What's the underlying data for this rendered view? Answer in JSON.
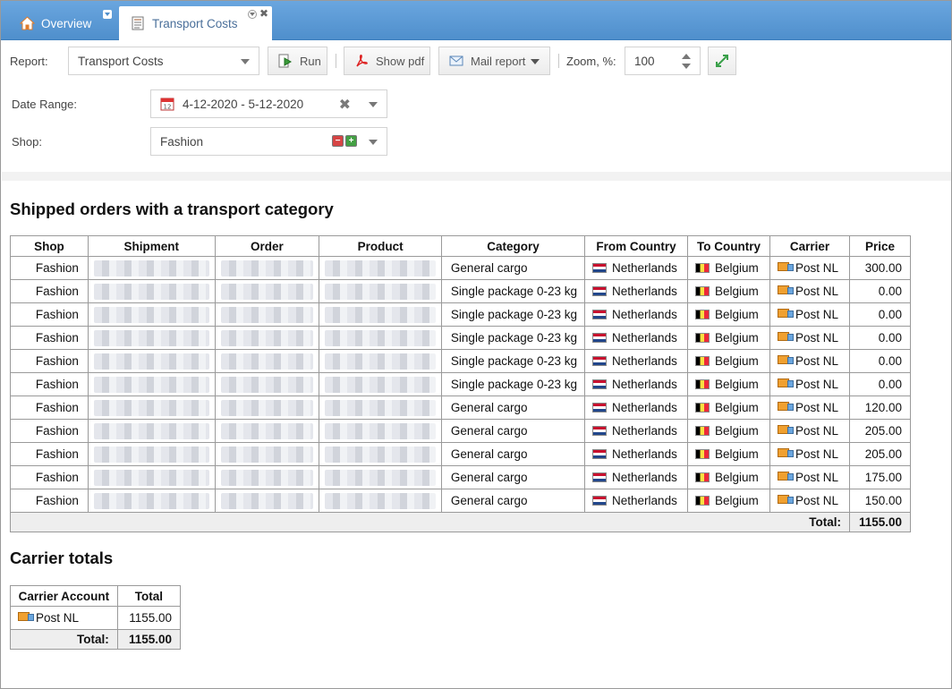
{
  "tabs": [
    {
      "label": "Overview",
      "icon": "home-icon",
      "active": false
    },
    {
      "label": "Transport Costs",
      "icon": "report-icon",
      "active": true
    }
  ],
  "toolbar": {
    "report_label": "Report:",
    "report_value": "Transport Costs",
    "run_label": "Run",
    "show_pdf_label": "Show pdf",
    "mail_report_label": "Mail report",
    "zoom_label": "Zoom, %:",
    "zoom_value": "100"
  },
  "filters": {
    "date_range_label": "Date Range:",
    "date_range_value": "4-12-2020 - 5-12-2020",
    "shop_label": "Shop:",
    "shop_value": "Fashion"
  },
  "shipped_orders": {
    "title": "Shipped orders with a transport category",
    "columns": [
      "Shop",
      "Shipment",
      "Order",
      "Product",
      "Category",
      "From Country",
      "To Country",
      "Carrier",
      "Price"
    ],
    "rows": [
      {
        "shop": "Fashion",
        "category": "General cargo",
        "from": "Netherlands",
        "to": "Belgium",
        "carrier": "Post NL",
        "price": "300.00"
      },
      {
        "shop": "Fashion",
        "category": "Single package 0-23 kg",
        "from": "Netherlands",
        "to": "Belgium",
        "carrier": "Post NL",
        "price": "0.00"
      },
      {
        "shop": "Fashion",
        "category": "Single package 0-23 kg",
        "from": "Netherlands",
        "to": "Belgium",
        "carrier": "Post NL",
        "price": "0.00"
      },
      {
        "shop": "Fashion",
        "category": "Single package 0-23 kg",
        "from": "Netherlands",
        "to": "Belgium",
        "carrier": "Post NL",
        "price": "0.00"
      },
      {
        "shop": "Fashion",
        "category": "Single package 0-23 kg",
        "from": "Netherlands",
        "to": "Belgium",
        "carrier": "Post NL",
        "price": "0.00"
      },
      {
        "shop": "Fashion",
        "category": "Single package 0-23 kg",
        "from": "Netherlands",
        "to": "Belgium",
        "carrier": "Post NL",
        "price": "0.00"
      },
      {
        "shop": "Fashion",
        "category": "General cargo",
        "from": "Netherlands",
        "to": "Belgium",
        "carrier": "Post NL",
        "price": "120.00"
      },
      {
        "shop": "Fashion",
        "category": "General cargo",
        "from": "Netherlands",
        "to": "Belgium",
        "carrier": "Post NL",
        "price": "205.00"
      },
      {
        "shop": "Fashion",
        "category": "General cargo",
        "from": "Netherlands",
        "to": "Belgium",
        "carrier": "Post NL",
        "price": "205.00"
      },
      {
        "shop": "Fashion",
        "category": "General cargo",
        "from": "Netherlands",
        "to": "Belgium",
        "carrier": "Post NL",
        "price": "175.00"
      },
      {
        "shop": "Fashion",
        "category": "General cargo",
        "from": "Netherlands",
        "to": "Belgium",
        "carrier": "Post NL",
        "price": "150.00"
      }
    ],
    "total_label": "Total:",
    "total_value": "1155.00"
  },
  "carrier_totals": {
    "title": "Carrier totals",
    "columns": [
      "Carrier Account",
      "Total"
    ],
    "rows": [
      {
        "carrier": "Post NL",
        "total": "1155.00"
      }
    ],
    "total_label": "Total:",
    "total_value": "1155.00"
  },
  "colors": {
    "tabbar": "#5b9bd5",
    "flag_nl": [
      "#c8102e",
      "#ffffff",
      "#21468b"
    ],
    "flag_be": [
      "#000000",
      "#fae042",
      "#ed2939"
    ]
  }
}
